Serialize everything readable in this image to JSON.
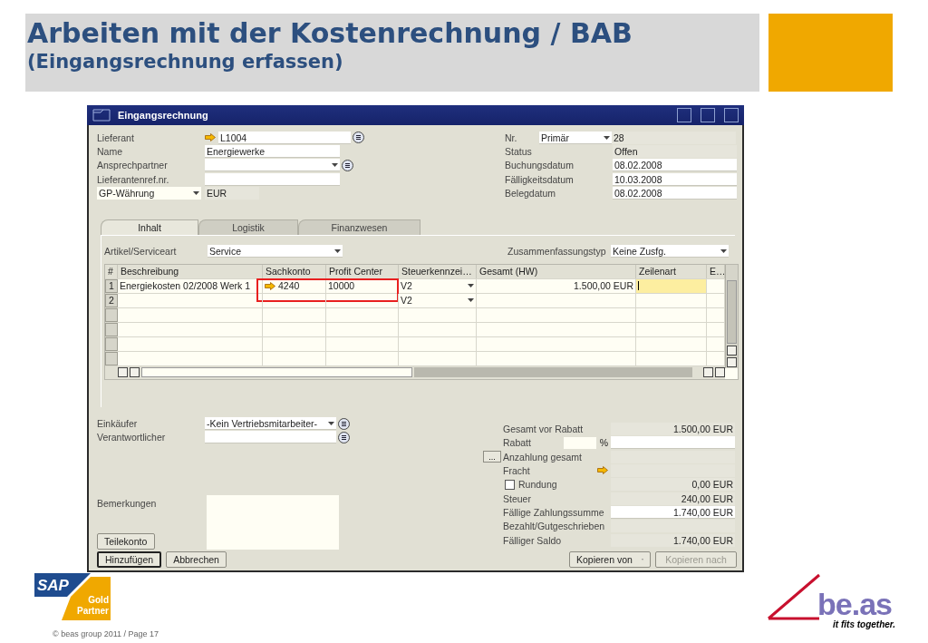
{
  "slide": {
    "title": "Arbeiten mit der Kostenrechnung / BAB",
    "subtitle": "(Eingangsrechnung erfassen)",
    "footer": "© beas group 2011 / Page 17",
    "sap_logo": {
      "brand": "SAP",
      "tier": "Gold",
      "program": "Partner"
    },
    "beas_logo": {
      "name": "be.as",
      "tagline": "it fits together."
    }
  },
  "window": {
    "title": "Eingangsrechnung",
    "header_left": [
      {
        "kind": "link",
        "label": "Lieferant",
        "value": "L1004"
      },
      {
        "kind": "plain",
        "label": "Name",
        "value": "Energiewerke"
      },
      {
        "kind": "combo",
        "label": "Ansprechpartner"
      },
      {
        "kind": "plain",
        "label": "Lieferantenref.nr."
      },
      {
        "kind": "selector",
        "label": "GP-Währung",
        "value": "EUR"
      }
    ],
    "header_right": [
      {
        "label": "Nr.",
        "series": "Primär",
        "value": "28",
        "readonly": true
      },
      {
        "label": "Status",
        "value": "Offen",
        "readonly": true
      },
      {
        "label": "Buchungsdatum",
        "value": "08.02.2008",
        "readonly": false
      },
      {
        "label": "Fälligkeitsdatum",
        "value": "10.03.2008",
        "readonly": false
      },
      {
        "label": "Belegdatum",
        "value": "08.02.2008",
        "readonly": false
      }
    ],
    "tabs": [
      {
        "label": "Inhalt",
        "selected": true
      },
      {
        "label": "Logistik",
        "selected": false
      },
      {
        "label": "Finanzwesen",
        "selected": false
      }
    ],
    "item_type": {
      "label": "Artikel/Serviceart",
      "value": "Service"
    },
    "summary_type": {
      "label": "Zusammenfassungstyp",
      "value": "Keine Zusfg."
    },
    "table": {
      "columns": [
        "#",
        "Beschreibung",
        "Sachkonto",
        "Profit Center",
        "Steuerkennzei…",
        "Gesamt (HW)",
        "Zeilenart",
        "E…"
      ],
      "rows": [
        {
          "number": "1",
          "description": "Energiekosten 02/2008 Werk 1",
          "account": "4240",
          "account_link": true,
          "profit_center": "10000",
          "tax": "V2",
          "total": "1.500,00 EUR",
          "line_type_focused": true,
          "marked": true
        },
        {
          "number": "2",
          "account_link": false,
          "tax": "V2",
          "line_type_focused": false,
          "marked": false
        }
      ]
    },
    "buyer": {
      "label": "Einkäufer",
      "value": "-Kein Vertriebsmitarbeiter-"
    },
    "owner": {
      "label": "Verantwortlicher"
    },
    "remarks": {
      "label": "Bemerkungen"
    },
    "totals": [
      {
        "kind": "plain",
        "label": "Gesamt vor Rabatt",
        "value": "1.500,00 EUR",
        "readonly": true
      },
      {
        "kind": "percent",
        "label": "Rabatt",
        "unit": "%",
        "readonly": false
      },
      {
        "kind": "more",
        "label": "Anzahlung gesamt",
        "button": "...",
        "readonly": true
      },
      {
        "kind": "link",
        "label": "Fracht",
        "readonly": true
      },
      {
        "kind": "check",
        "label": "Rundung",
        "checked": false,
        "value": "0,00 EUR",
        "readonly": true
      },
      {
        "kind": "plain",
        "label": "Steuer",
        "value": "240,00 EUR",
        "readonly": true
      },
      {
        "kind": "plain",
        "label": "Fällige Zahlungssumme",
        "value": "1.740,00 EUR",
        "readonly": false
      },
      {
        "kind": "plain",
        "label": "Bezahlt/Gutgeschrieben",
        "readonly": true
      },
      {
        "kind": "plain",
        "label": "Fälliger Saldo",
        "value": "1.740,00 EUR",
        "readonly": true
      }
    ],
    "partial_button": {
      "label": "Teilekonto"
    },
    "buttons_left": [
      {
        "label": "Hinzufügen",
        "default": true
      },
      {
        "label": "Abbrechen",
        "default": false
      }
    ],
    "buttons_right": [
      {
        "label": "Kopieren von",
        "menu": true,
        "disabled": false
      },
      {
        "label": "Kopieren nach",
        "menu": false,
        "disabled": true
      }
    ]
  }
}
